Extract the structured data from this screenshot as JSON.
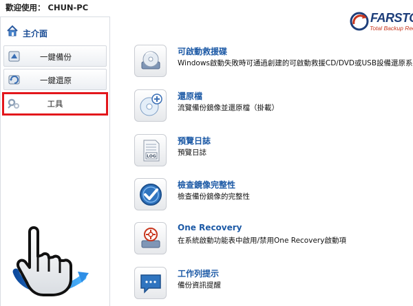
{
  "header": {
    "welcome": "歡迎使用： CHUN-PC",
    "logo_text": "FARSTO",
    "logo_tagline": "Total Backup Reco"
  },
  "sidebar": {
    "title": "主介面",
    "items": [
      {
        "label": "一鍵備份",
        "icon": "backup-icon"
      },
      {
        "label": "一鍵還原",
        "icon": "restore-icon"
      },
      {
        "label": "工具",
        "icon": "tools-icon",
        "selected": true
      }
    ]
  },
  "tasks": [
    {
      "title": "可啟動救援碟",
      "description": "Windows啟動失敗時可通過創建的可啟動救援CD/DVD或USB設備還原系統",
      "icon": "boot-disc-icon"
    },
    {
      "title": "還原檔",
      "description": "流覽備份鏡像並還原檔（掛載）",
      "icon": "disc-add-icon"
    },
    {
      "title": "預覽日誌",
      "description": "預覽日誌",
      "icon": "log-icon"
    },
    {
      "title": "檢查鏡像完整性",
      "description": "檢查備份鏡像的完整性",
      "icon": "check-icon"
    },
    {
      "title": "One Recovery",
      "description": "在系統啟動功能表中啟用/禁用One Recovery啟動項",
      "icon": "one-recovery-icon"
    },
    {
      "title": "工作列提示",
      "description": "備份資訊提醒",
      "icon": "message-icon"
    }
  ],
  "colors": {
    "link_blue": "#1d5aa6",
    "highlight_red": "#e3161b",
    "brand_navy": "#1d3e7a",
    "brand_red": "#c8351c"
  }
}
